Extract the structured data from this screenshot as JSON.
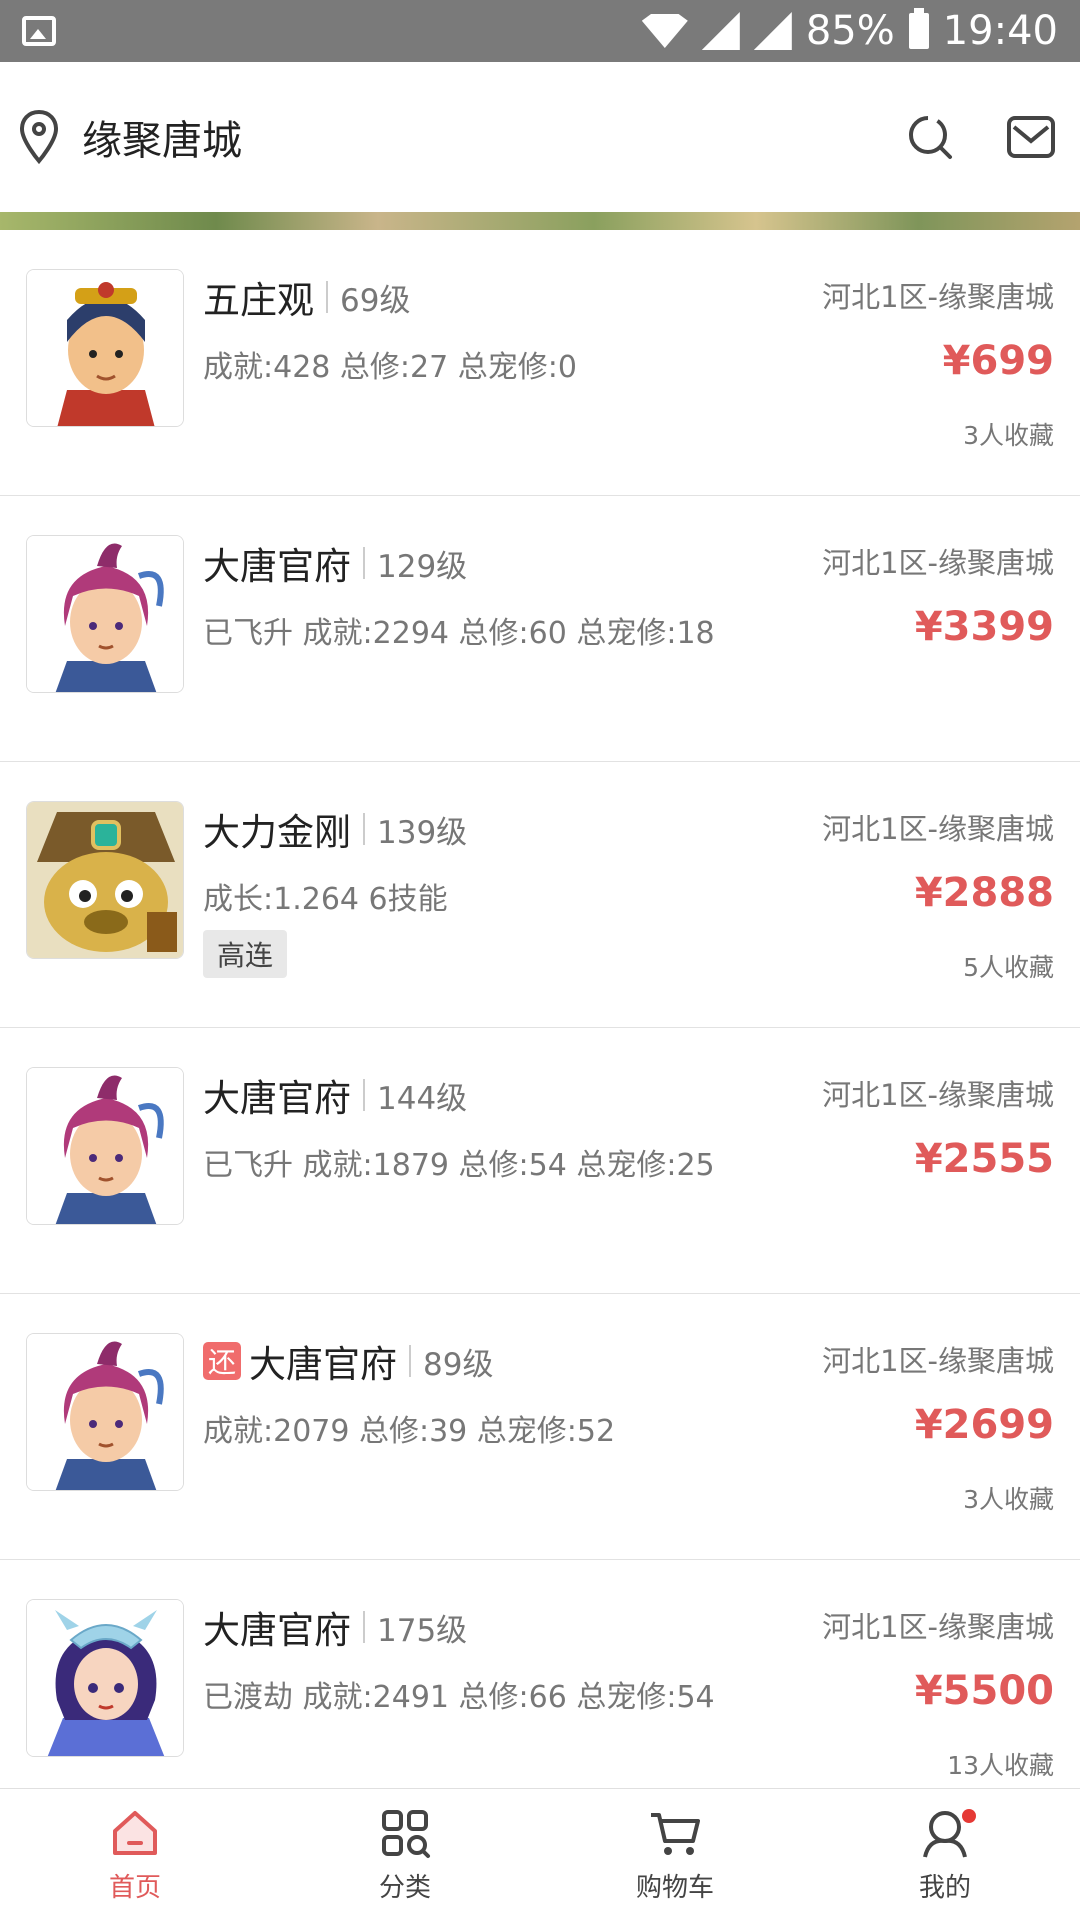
{
  "status_bar": {
    "battery": "85%",
    "time": "19:40"
  },
  "header": {
    "location": "缘聚唐城"
  },
  "listings": [
    {
      "name": "五庄观",
      "level": "69级",
      "server": "河北1区-缘聚唐城",
      "stats": "成就:428 总修:27 总宠修:0",
      "price": "¥699",
      "favorites": "3人收藏",
      "tag": "",
      "returned": "",
      "avatar": "boy-red"
    },
    {
      "name": "大唐官府",
      "level": "129级",
      "server": "河北1区-缘聚唐城",
      "stats": "已飞升 成就:2294 总修:60 总宠修:18",
      "price": "¥3399",
      "favorites": "",
      "tag": "",
      "returned": "",
      "avatar": "girl-pink"
    },
    {
      "name": "大力金刚",
      "level": "139级",
      "server": "河北1区-缘聚唐城",
      "stats": "成长:1.264 6技能",
      "price": "¥2888",
      "favorites": "5人收藏",
      "tag": "高连",
      "returned": "",
      "avatar": "monster"
    },
    {
      "name": "大唐官府",
      "level": "144级",
      "server": "河北1区-缘聚唐城",
      "stats": "已飞升 成就:1879 总修:54 总宠修:25",
      "price": "¥2555",
      "favorites": "",
      "tag": "",
      "returned": "",
      "avatar": "girl-pink"
    },
    {
      "name": "大唐官府",
      "level": "89级",
      "server": "河北1区-缘聚唐城",
      "stats": "成就:2079 总修:39 总宠修:52",
      "price": "¥2699",
      "favorites": "3人收藏",
      "tag": "",
      "returned": "还",
      "avatar": "girl-pink"
    },
    {
      "name": "大唐官府",
      "level": "175级",
      "server": "河北1区-缘聚唐城",
      "stats": "已渡劫 成就:2491 总修:66 总宠修:54",
      "price": "¥5500",
      "favorites": "13人收藏",
      "tag": "",
      "returned": "",
      "avatar": "girl-blue"
    }
  ],
  "tabs": [
    {
      "label": "首页",
      "icon": "home-icon",
      "active": true
    },
    {
      "label": "分类",
      "icon": "category-icon",
      "active": false
    },
    {
      "label": "购物车",
      "icon": "cart-icon",
      "active": false
    },
    {
      "label": "我的",
      "icon": "profile-icon",
      "active": false
    }
  ],
  "colors": {
    "accent": "#e05a5a",
    "status_bar": "#7a7a7a"
  }
}
